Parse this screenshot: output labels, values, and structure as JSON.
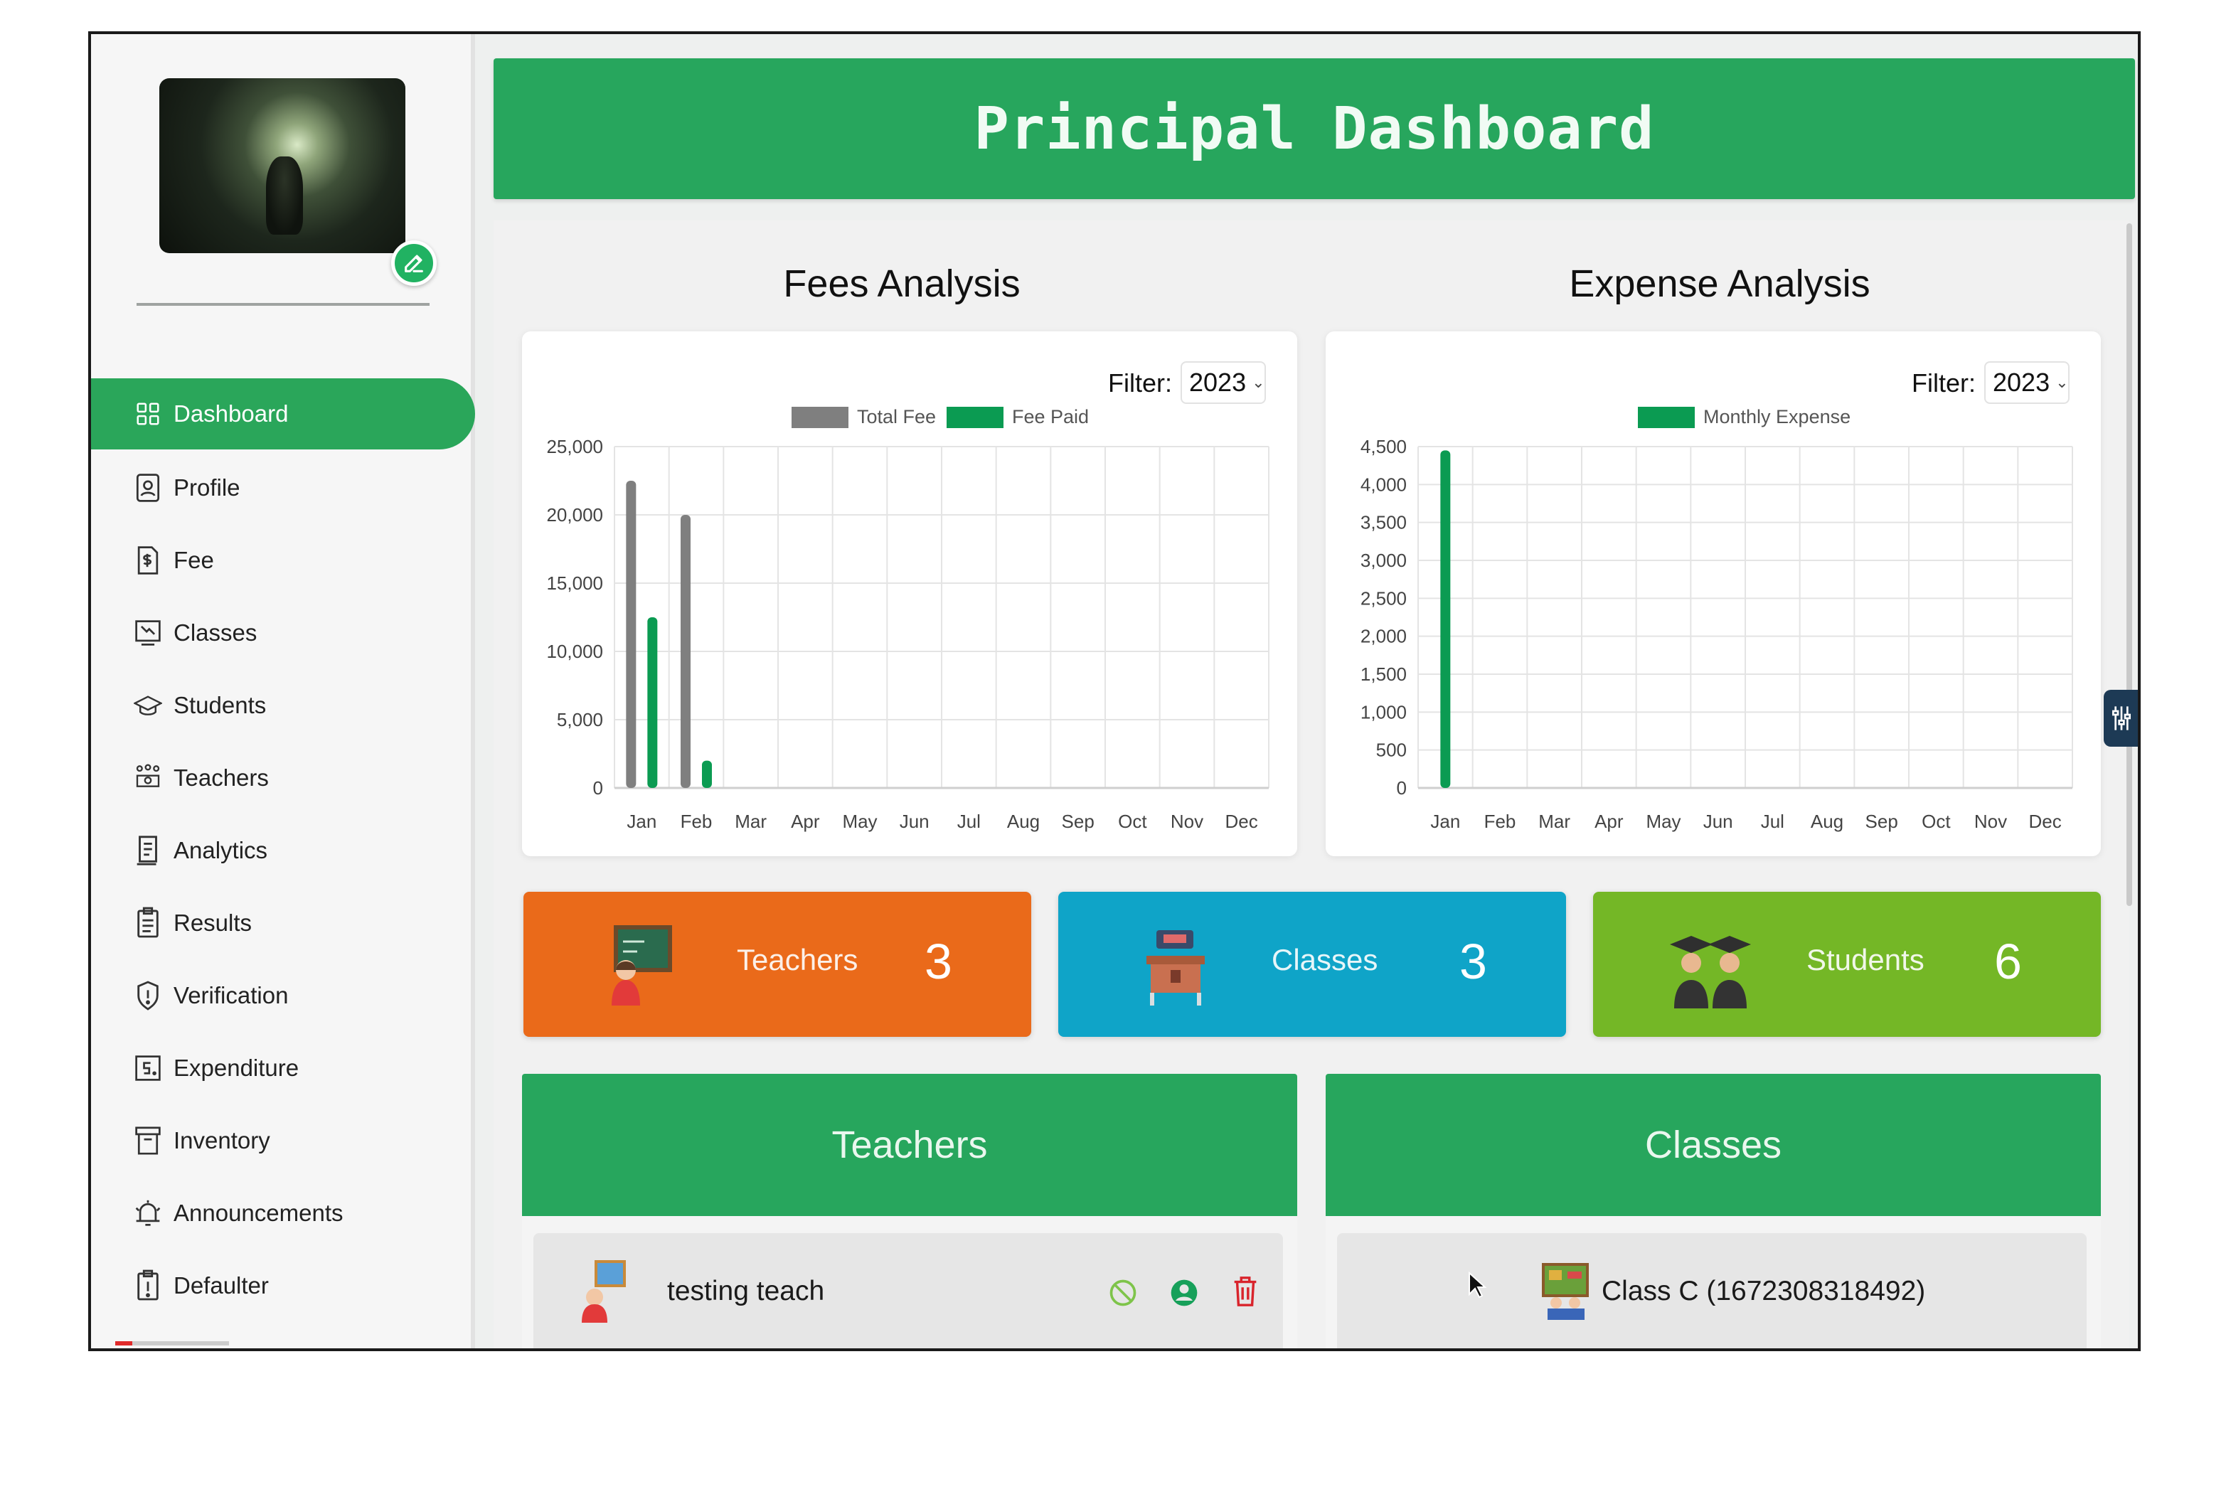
{
  "header": {
    "title": "Principal Dashboard"
  },
  "sidebar": {
    "items": [
      {
        "label": "Dashboard",
        "icon": "grid-icon",
        "active": true
      },
      {
        "label": "Profile",
        "icon": "profile-icon"
      },
      {
        "label": "Fee",
        "icon": "fee-icon"
      },
      {
        "label": "Classes",
        "icon": "classes-icon"
      },
      {
        "label": "Students",
        "icon": "graduation-cap-icon"
      },
      {
        "label": "Teachers",
        "icon": "teachers-icon"
      },
      {
        "label": "Analytics",
        "icon": "analytics-icon"
      },
      {
        "label": "Results",
        "icon": "results-icon"
      },
      {
        "label": "Verification",
        "icon": "shield-icon"
      },
      {
        "label": "Expenditure",
        "icon": "expenditure-icon"
      },
      {
        "label": "Inventory",
        "icon": "inventory-icon"
      },
      {
        "label": "Announcements",
        "icon": "bell-icon"
      },
      {
        "label": "Defaulter",
        "icon": "alert-icon"
      }
    ]
  },
  "fees": {
    "title": "Fees Analysis",
    "filter_label": "Filter:",
    "filter_value": "2023"
  },
  "expense": {
    "title": "Expense Analysis",
    "filter_label": "Filter:",
    "filter_value": "2023"
  },
  "stats": [
    {
      "label": "Teachers",
      "value": "3",
      "color": "#ea6a1a"
    },
    {
      "label": "Classes",
      "value": "3",
      "color": "#0fa4c8"
    },
    {
      "label": "Students",
      "value": "6",
      "color": "#74b726"
    }
  ],
  "lists": {
    "teachers": {
      "title": "Teachers",
      "rows": [
        {
          "name": "testing teach"
        }
      ]
    },
    "classes": {
      "title": "Classes",
      "rows": [
        {
          "name": "Class C  (1672308318492)"
        }
      ]
    }
  },
  "colors": {
    "accent": "#27a65d",
    "total_fee": "#7f7f7f",
    "fee_paid": "#0b9b52",
    "expense": "#0b9b52",
    "delete": "#d9242c"
  },
  "chart_data": [
    {
      "type": "bar",
      "title": "Fees Analysis",
      "categories": [
        "Jan",
        "Feb",
        "Mar",
        "Apr",
        "May",
        "Jun",
        "Jul",
        "Aug",
        "Sep",
        "Oct",
        "Nov",
        "Dec"
      ],
      "series": [
        {
          "name": "Total Fee",
          "values": [
            22500,
            20000,
            0,
            0,
            0,
            0,
            0,
            0,
            0,
            0,
            0,
            0
          ]
        },
        {
          "name": "Fee Paid",
          "values": [
            12500,
            2000,
            0,
            0,
            0,
            0,
            0,
            0,
            0,
            0,
            0,
            0
          ]
        }
      ],
      "yticks": [
        "0",
        "5,000",
        "10,000",
        "15,000",
        "20,000",
        "25,000"
      ],
      "ylim": [
        0,
        25000
      ],
      "grid": true,
      "legend": "top-center"
    },
    {
      "type": "bar",
      "title": "Expense Analysis",
      "categories": [
        "Jan",
        "Feb",
        "Mar",
        "Apr",
        "May",
        "Jun",
        "Jul",
        "Aug",
        "Sep",
        "Oct",
        "Nov",
        "Dec"
      ],
      "series": [
        {
          "name": "Monthly Expense",
          "values": [
            4450,
            0,
            0,
            0,
            0,
            0,
            0,
            0,
            0,
            0,
            0,
            0
          ]
        }
      ],
      "yticks": [
        "0",
        "500",
        "1,000",
        "1,500",
        "2,000",
        "2,500",
        "3,000",
        "3,500",
        "4,000",
        "4,500"
      ],
      "ylim": [
        0,
        4500
      ],
      "grid": true,
      "legend": "top-center"
    }
  ]
}
